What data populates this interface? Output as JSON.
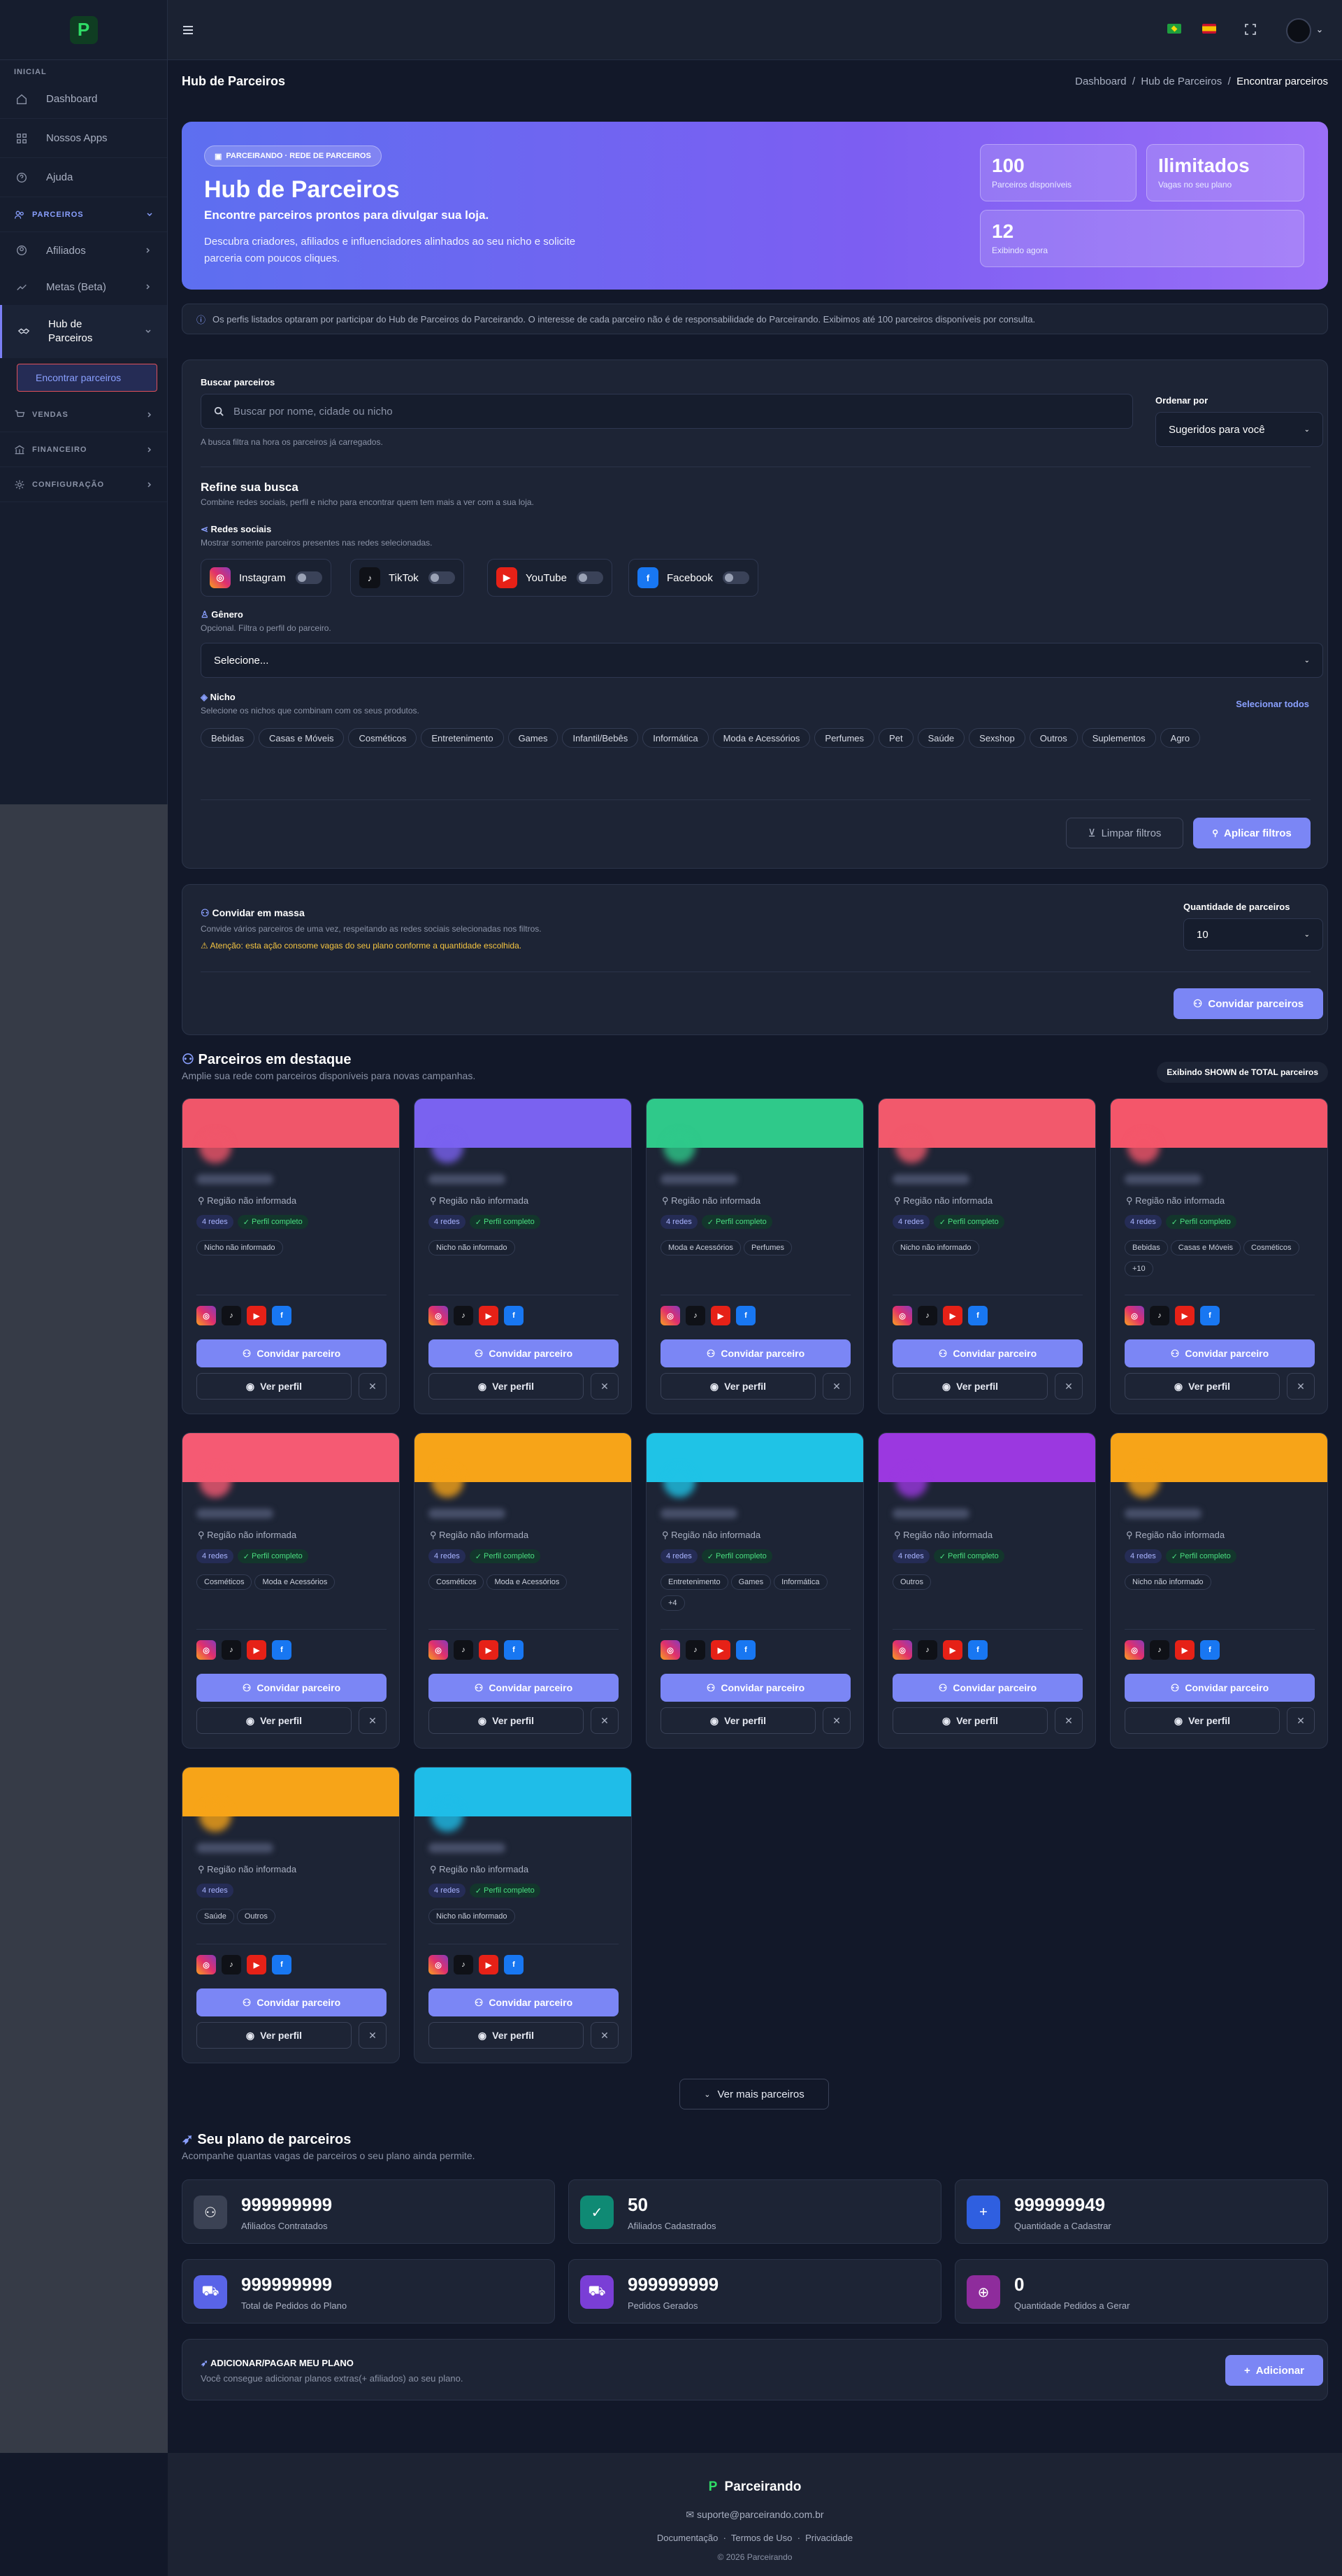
{
  "sidebar": {
    "logo_letter": "P",
    "section_inicial": "INICIAL",
    "items": [
      {
        "label": "Dashboard",
        "icon": "home-icon"
      },
      {
        "label": "Nossos Apps",
        "icon": "grid-icon"
      },
      {
        "label": "Ajuda",
        "icon": "help-icon"
      }
    ],
    "group_parceiros": "PARCEIROS",
    "parceiros_items": [
      {
        "label": "Afiliados"
      },
      {
        "label": "Metas (Beta)"
      }
    ],
    "hub_label": "Hub de Parceiros",
    "hub_sub": "Encontrar parceiros",
    "group_vendas": "VENDAS",
    "group_financeiro": "FINANCEIRO",
    "group_config": "CONFIGURAÇÃO"
  },
  "header": {
    "page_title": "Hub de Parceiros",
    "crumbs": [
      "Dashboard",
      "Hub de Parceiros",
      "Encontrar parceiros"
    ]
  },
  "hero": {
    "pill": "PARCEIRANDO · REDE DE PARCEIROS",
    "title": "Hub de Parceiros",
    "subtitle": "Encontre parceiros prontos para divulgar sua loja.",
    "description": "Descubra criadores, afiliados e influenciadores alinhados ao seu nicho e solicite parceria com poucos cliques.",
    "stats": [
      {
        "value": "100",
        "label": "Parceiros disponíveis"
      },
      {
        "value": "Ilimitados",
        "label": "Vagas no seu plano"
      },
      {
        "value": "12",
        "label": "Exibindo agora"
      }
    ]
  },
  "info_text": "Os perfis listados optaram por participar do Hub de Parceiros do Parceirando. O interesse de cada parceiro não é de responsabilidade do Parceirando. Exibimos até 100 parceiros disponíveis por consulta.",
  "filters": {
    "search_label": "Buscar parceiros",
    "search_placeholder": "Buscar por nome, cidade ou nicho",
    "search_hint": "A busca filtra na hora os parceiros já carregados.",
    "order_label": "Ordenar por",
    "order_value": "Sugeridos para você",
    "refine_title": "Refine sua busca",
    "refine_hint": "Combine redes sociais, perfil e nicho para encontrar quem tem mais a ver com a sua loja.",
    "social_title": "Redes sociais",
    "social_hint": "Mostrar somente parceiros presentes nas redes selecionadas.",
    "socials": [
      "Instagram",
      "TikTok",
      "YouTube",
      "Facebook"
    ],
    "gender_title": "Gênero",
    "gender_hint": "Opcional. Filtra o perfil do parceiro.",
    "gender_value": "Selecione...",
    "niche_title": "Nicho",
    "niche_hint": "Selecione os nichos que combinam com os seus produtos.",
    "select_all": "Selecionar todos",
    "niches": [
      "Bebidas",
      "Casas e Móveis",
      "Cosméticos",
      "Entretenimento",
      "Games",
      "Infantil/Bebês",
      "Informática",
      "Moda e Acessórios",
      "Perfumes",
      "Pet",
      "Saúde",
      "Sexshop",
      "Outros",
      "Suplementos",
      "Agro"
    ],
    "clear_label": "Limpar filtros",
    "apply_label": "Aplicar filtros"
  },
  "bulk": {
    "title": "Convidar em massa",
    "description": "Convide vários parceiros de uma vez, respeitando as redes sociais selecionadas nos filtros.",
    "warning": "Atenção: esta ação consome vagas do seu plano conforme a quantidade escolhida.",
    "qty_label": "Quantidade de parceiros",
    "qty_value": "10",
    "button": "Convidar parceiros"
  },
  "featured": {
    "title": "Parceiros em destaque",
    "subtitle": "Amplie sua rede com parceiros disponíveis para novas campanhas.",
    "counter": "Exibindo SHOWN de TOTAL parceiros",
    "region": "Região não informada",
    "networks_badge": "4 redes",
    "complete_badge": "Perfil completo",
    "invite_label": "Convidar parceiro",
    "view_label": "Ver perfil",
    "more_label": "Ver mais parceiros",
    "cards": [
      {
        "color": "#f0566a",
        "badges": true,
        "niches": [
          "Nicho não informado"
        ]
      },
      {
        "color": "#7a62f0",
        "badges": true,
        "niches": [
          "Nicho não informado"
        ]
      },
      {
        "color": "#2fc98a",
        "badges": true,
        "niches": [
          "Moda e Acessórios",
          "Perfumes"
        ]
      },
      {
        "color": "#f2596c",
        "badges": true,
        "niches": [
          "Nicho não informado"
        ]
      },
      {
        "color": "#f4566a",
        "badges": true,
        "niches": [
          "Bebidas",
          "Casas e Móveis",
          "Cosméticos",
          "+10"
        ]
      },
      {
        "color": "#f55a73",
        "badges": true,
        "niches": [
          "Cosméticos",
          "Moda e Acessórios"
        ]
      },
      {
        "color": "#f7a418",
        "badges": true,
        "niches": [
          "Cosméticos",
          "Moda e Acessórios"
        ]
      },
      {
        "color": "#1fc3e6",
        "badges": true,
        "niches": [
          "Entretenimento",
          "Games",
          "Informática",
          "+4"
        ]
      },
      {
        "color": "#9b38e0",
        "badges": true,
        "niches": [
          "Outros"
        ]
      },
      {
        "color": "#f7a418",
        "badges": true,
        "niches": [
          "Nicho não informado"
        ]
      },
      {
        "color": "#f7a418",
        "badges": false,
        "niches": [
          "Saúde",
          "Outros"
        ]
      },
      {
        "color": "#1fbde8",
        "badges": true,
        "niches": [
          "Nicho não informado"
        ]
      }
    ]
  },
  "plan": {
    "title": "Seu plano de parceiros",
    "subtitle": "Acompanhe quantas vagas de parceiros o seu plano ainda permite.",
    "cards": [
      {
        "value": "999999999",
        "label": "Afiliados Contratados",
        "color": "#3b4254",
        "icon": "handshake-icon"
      },
      {
        "value": "50",
        "label": "Afiliados Cadastrados",
        "color": "#0f8a74",
        "icon": "user-check-icon"
      },
      {
        "value": "999999949",
        "label": "Quantidade a Cadastrar",
        "color": "#2f5fe0",
        "icon": "user-plus-icon"
      },
      {
        "value": "999999999",
        "label": "Total de Pedidos do Plano",
        "color": "#5964e8",
        "icon": "cart-icon"
      },
      {
        "value": "999999999",
        "label": "Pedidos Gerados",
        "color": "#7a3ed6",
        "icon": "cart-icon"
      },
      {
        "value": "0",
        "label": "Quantidade Pedidos a Gerar",
        "color": "#8e2c9c",
        "icon": "cart-plus-icon"
      }
    ],
    "add_title": "ADICIONAR/PAGAR MEU PLANO",
    "add_desc": "Você consegue adicionar planos extras(+ afiliados) ao seu plano.",
    "add_button": "Adicionar"
  },
  "footer": {
    "brand": "Parceirando",
    "email": "suporte@parceirando.com.br",
    "links": [
      "Documentação",
      "Termos de Uso",
      "Privacidade"
    ],
    "copyright": "© 2026 Parceirando"
  }
}
